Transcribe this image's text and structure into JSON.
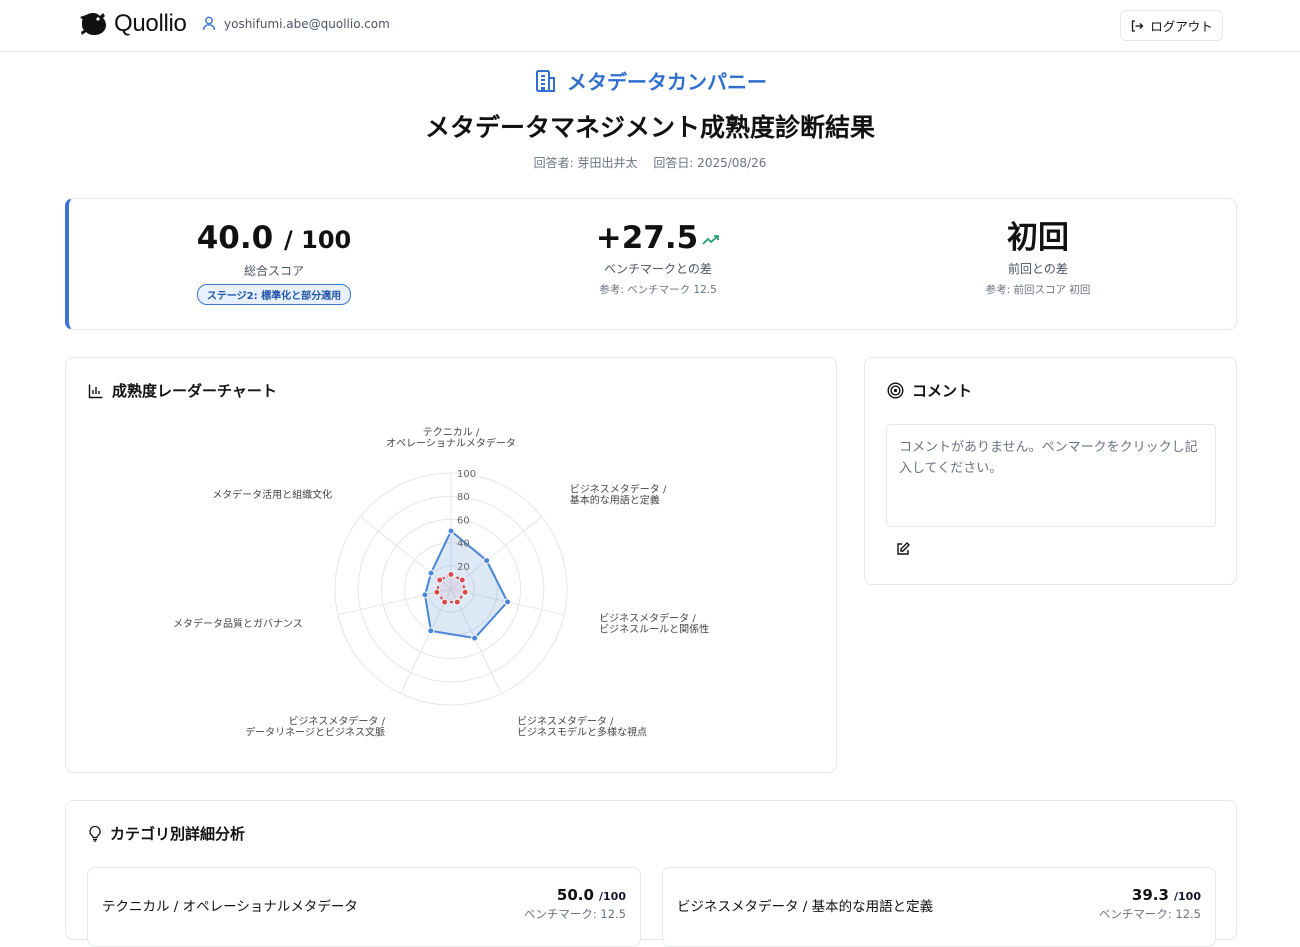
{
  "header": {
    "brand": "Quollio",
    "user_email": "yoshifumi.abe@quollio.com",
    "logout_label": "ログアウト"
  },
  "company_name": "メタデータカンパニー",
  "page_title": "メタデータマネジメント成熟度診断結果",
  "meta": {
    "respondent": "回答者: 芽田出井太",
    "date": "回答日: 2025/08/26"
  },
  "summary": {
    "total_score": "40.0",
    "total_max": "/ 100",
    "total_label": "総合スコア",
    "stage_badge": "ステージ2: 標準化と部分適用",
    "bench_diff": "+27.5",
    "bench_label": "ベンチマークとの差",
    "bench_ref": "参考: ベンチマーク 12.5",
    "prev_value": "初回",
    "prev_label": "前回との差",
    "prev_ref": "参考: 前回スコア 初回",
    "trend_color": "#22a06b"
  },
  "radar": {
    "title": "成熟度レーダーチャート"
  },
  "chart_data": {
    "type": "radar",
    "axes": [
      [
        "テクニカル /",
        "オペレーショナルメタデータ"
      ],
      [
        "ビジネスメタデータ /",
        "基本的な用語と定義"
      ],
      [
        "ビジネスメタデータ /",
        "ビジネスルールと関係性"
      ],
      [
        "ビジネスメタデータ /",
        "ビジネスモデルと多様な視点"
      ],
      [
        "ビジネスメタデータ /",
        "データリネージとビジネス文脈"
      ],
      [
        "メタデータ品質とガバナンス"
      ],
      [
        "メタデータ活用と組織文化"
      ]
    ],
    "range": [
      0,
      100
    ],
    "ticks": [
      "20",
      "40",
      "60",
      "80",
      "100"
    ],
    "series": [
      {
        "values": [
          50.0,
          39.3,
          50,
          47,
          40,
          23,
          22
        ],
        "color": "#4a86d8",
        "fill": "rgba(74,134,216,0.18)"
      },
      {
        "values": [
          12.5,
          12.5,
          12.5,
          12.5,
          12.5,
          12.5,
          12.5
        ],
        "color": "#d94b4b",
        "fill": "rgba(217,75,75,0.08)"
      }
    ]
  },
  "comment": {
    "title": "コメント",
    "placeholder": "コメントがありません。ペンマークをクリックし記入してください。"
  },
  "categories": {
    "title": "カテゴリ別詳細分析",
    "items": [
      {
        "name": "テクニカル / オペレーショナルメタデータ",
        "score": "50.0",
        "max": "/100",
        "bench": "ベンチマーク: 12.5"
      },
      {
        "name": "ビジネスメタデータ / 基本的な用語と定義",
        "score": "39.3",
        "max": "/100",
        "bench": "ベンチマーク: 12.5"
      }
    ]
  }
}
